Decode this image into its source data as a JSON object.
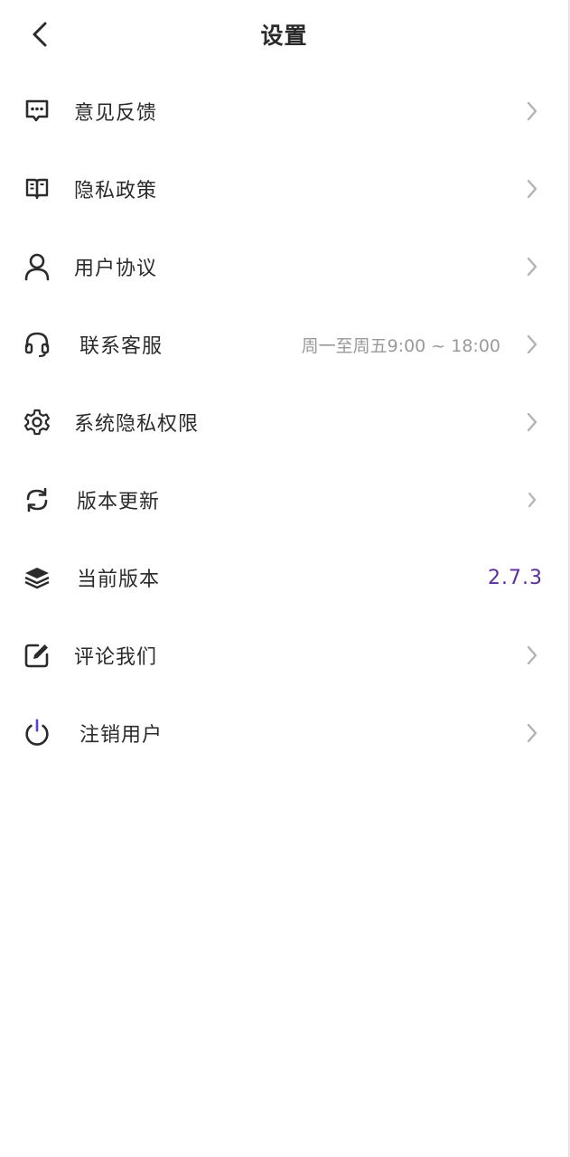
{
  "header": {
    "title": "设置",
    "back_icon": "chevron-left-icon"
  },
  "menu": {
    "items": [
      {
        "label": "意见反馈",
        "icon": "feedback-chat-icon"
      },
      {
        "label": "隐私政策",
        "icon": "open-book-icon"
      },
      {
        "label": "用户协议",
        "icon": "user-icon"
      },
      {
        "label": "联系客服",
        "icon": "headset-icon",
        "hint": "周一至周五9:00 ~ 18:00"
      },
      {
        "label": "系统隐私权限",
        "icon": "gear-icon"
      },
      {
        "label": "版本更新",
        "icon": "refresh-icon"
      },
      {
        "label": "当前版本",
        "icon": "layers-icon",
        "value": "2.7.3"
      },
      {
        "label": "评论我们",
        "icon": "edit-icon"
      },
      {
        "label": "注销用户",
        "icon": "power-icon"
      }
    ]
  },
  "colors": {
    "text": "#2b2b2b",
    "hint": "#9a9a9a",
    "chevron": "#b3b3b3",
    "version": "#5b2d9e",
    "power_accent": "#5b3fd6"
  }
}
